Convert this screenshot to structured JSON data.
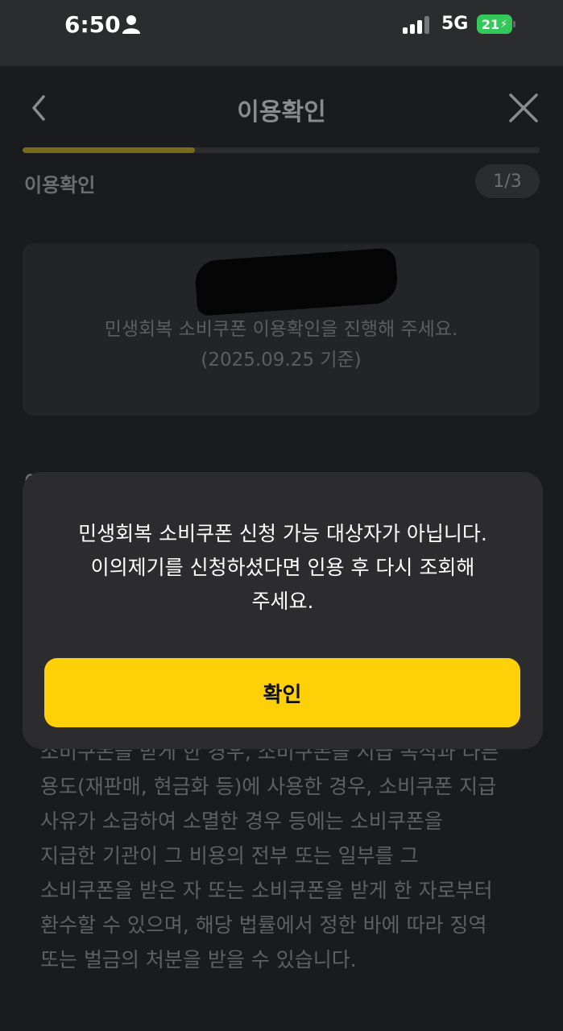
{
  "status_bar": {
    "time": "6:50",
    "network": "5G",
    "battery": "21",
    "battery_color": "#34c759"
  },
  "nav": {
    "title": "이용확인",
    "back_icon": "chevron-left-icon",
    "close_icon": "close-icon"
  },
  "progress": {
    "current_step": 1,
    "total_steps": 3,
    "fraction": 0.333
  },
  "section": {
    "title": "이용확인",
    "step_label": "1/3"
  },
  "info_card": {
    "line1": "민생회복 소비쿠폰 이용확인을 진행해 주세요.",
    "line2": "(2025.09.25 기준)"
  },
  "partial_heading": "이용확인",
  "body": {
    "lines": [
      "소비쿠폰을 받게 한 경우, 소비쿠폰을 지급 목적과 다른",
      "용도(재판매, 현금화 등)에 사용한 경우, 소비쿠폰 지급",
      "사유가 소급하여 소멸한 경우 등에는 소비쿠폰을",
      "지급한 기관이 그 비용의 전부 또는 일부를 그",
      "소비쿠폰을 받은 자 또는 소비쿠폰을 받게 한 자로부터",
      "환수할 수 있으며, 해당 법률에서 정한 바에 따라 징역",
      "또는 벌금의 처분을 받을 수 있습니다."
    ]
  },
  "dialog": {
    "message_line1": "민생회복 소비쿠폰 신청 가능 대상자가 아닙니다.",
    "message_line2": "이의제기를 신청하셨다면 인용 후 다시 조회해",
    "message_line3": "주세요.",
    "confirm_label": "확인",
    "accent": "#fdd008"
  }
}
